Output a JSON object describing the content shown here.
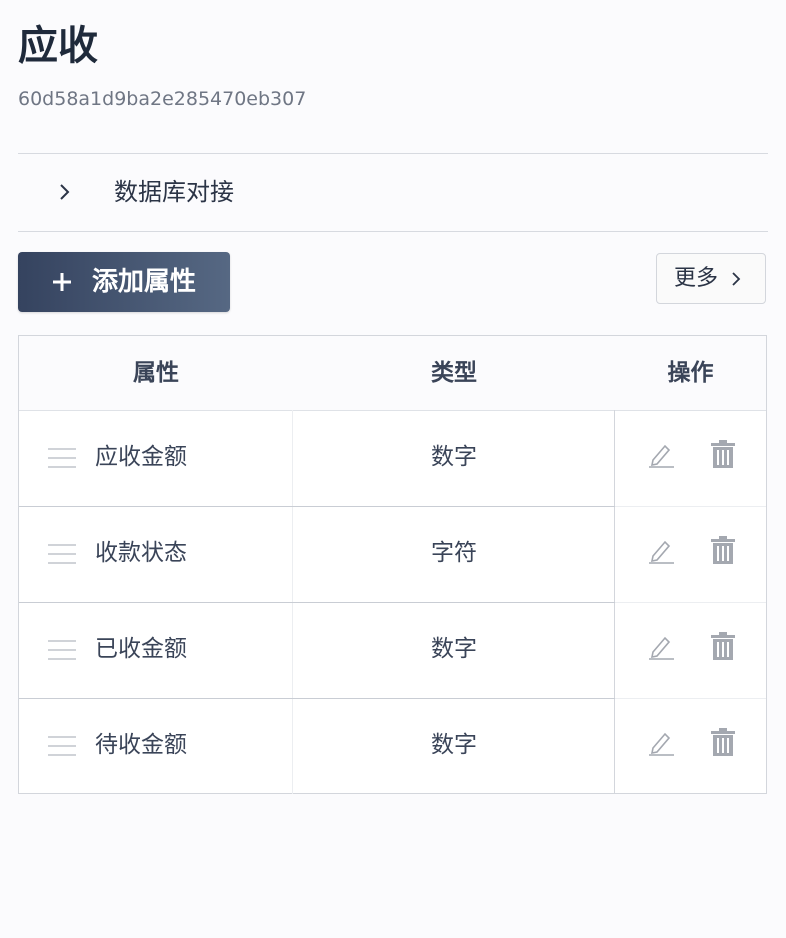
{
  "header": {
    "title": "应收",
    "id": "60d58a1d9ba2e285470eb307"
  },
  "collapse": {
    "label": "数据库对接",
    "icon": "chevron-right-icon"
  },
  "toolbar": {
    "add_label": "添加属性",
    "add_icon": "plus-icon",
    "more_label": "更多",
    "more_icon": "chevron-right-icon"
  },
  "table": {
    "columns": [
      "属性",
      "类型",
      "操作"
    ],
    "rows": [
      {
        "name": "应收金额",
        "type": "数字"
      },
      {
        "name": "收款状态",
        "type": "字符"
      },
      {
        "name": "已收金额",
        "type": "数字"
      },
      {
        "name": "待收金额",
        "type": "数字"
      }
    ],
    "row_icons": {
      "drag": "drag-handle-icon",
      "edit": "edit-pencil-icon",
      "delete": "trash-icon"
    }
  },
  "colors": {
    "button_start": "#35435f",
    "button_end": "#566883",
    "text": "#2b3446",
    "muted": "#6f7684",
    "icon": "#a4a8b0"
  }
}
